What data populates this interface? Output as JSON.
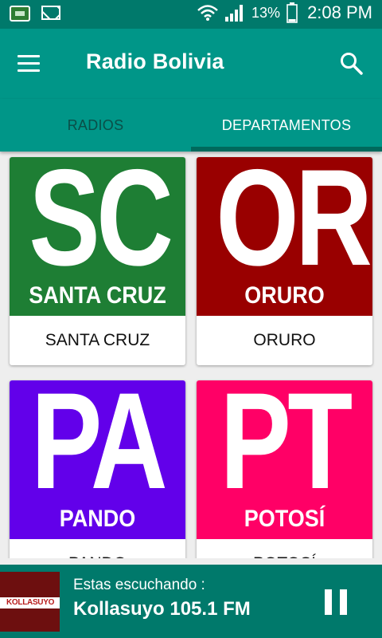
{
  "status_bar": {
    "battery_percent": "13%",
    "time": "2:08 PM",
    "icons": [
      "radio-app-icon",
      "mail-icon",
      "wifi-icon",
      "signal-icon",
      "battery-icon"
    ]
  },
  "app_bar": {
    "title": "Radio Bolivia",
    "menu_icon": "menu-icon",
    "search_icon": "search-icon",
    "color": "#009688"
  },
  "tabs": [
    {
      "label": "RADIOS",
      "selected": false
    },
    {
      "label": "DEPARTAMENTOS",
      "selected": true
    }
  ],
  "departments": [
    {
      "abbr": "SC",
      "image_label": "SANTA CRUZ",
      "label": "SANTA CRUZ",
      "color": "#1e7e34"
    },
    {
      "abbr": "OR",
      "image_label": "ORURO",
      "label": "ORURO",
      "color": "#990000"
    },
    {
      "abbr": "PA",
      "image_label": "PANDO",
      "label": "PANDO",
      "color": "#6200ea"
    },
    {
      "abbr": "PT",
      "image_label": "POTOSÍ",
      "label": "POTOSÍ",
      "color": "#ff0066"
    }
  ],
  "player": {
    "caption": "Estas escuchando :",
    "station": "Kollasuyo 105.1 FM",
    "thumb_text": "KOLLASUYO",
    "state": "playing",
    "pause_icon": "pause-icon"
  }
}
